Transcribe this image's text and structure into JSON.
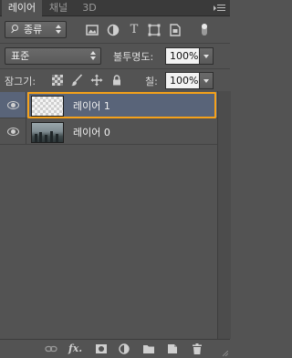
{
  "tabs": [
    {
      "label": "레이어",
      "active": true
    },
    {
      "label": "채널",
      "active": false
    },
    {
      "label": "3D",
      "active": false
    }
  ],
  "filter": {
    "kind_label": "종류",
    "icons": [
      "pixel-layer-filter-icon",
      "adjustment-layer-filter-icon",
      "type-layer-filter-icon",
      "shape-layer-filter-icon",
      "smart-object-filter-icon"
    ],
    "type_glyph": "T"
  },
  "blend": {
    "mode": "표준",
    "opacity_label": "불투명도:",
    "opacity_value": "100%"
  },
  "lock": {
    "label": "잠그기:",
    "fill_label": "칠:",
    "fill_value": "100%"
  },
  "layers": [
    {
      "name": "레이어 1",
      "visible": true,
      "selected": true,
      "thumbnail": "transparent"
    },
    {
      "name": "레이어 0",
      "visible": true,
      "selected": false,
      "thumbnail": "photo"
    }
  ],
  "footer": {
    "fx_label": "fx.",
    "icons": [
      "link-layers-icon",
      "layer-style-icon",
      "add-mask-icon",
      "adjustment-layer-icon",
      "new-group-icon",
      "new-layer-icon",
      "delete-layer-icon"
    ]
  },
  "colors": {
    "panel_bg": "#535353",
    "selection_row": "#596479",
    "selection_outline": "#f5a11a"
  }
}
